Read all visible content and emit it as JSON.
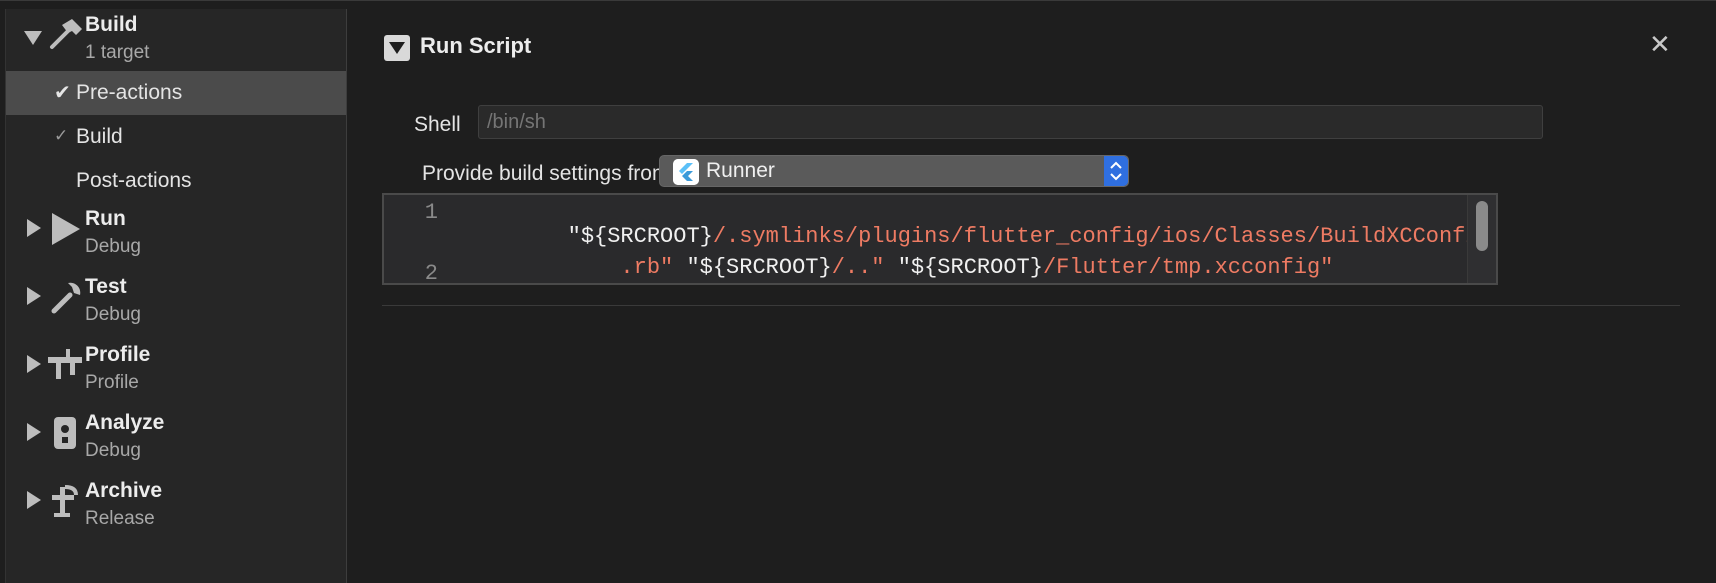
{
  "sidebar": {
    "schemes": [
      {
        "title": "Build",
        "subtitle": "1 target",
        "icon": "hammer-icon",
        "expanded": true
      },
      {
        "title": "Run",
        "subtitle": "Debug",
        "icon": "play-icon",
        "expanded": false
      },
      {
        "title": "Test",
        "subtitle": "Debug",
        "icon": "wrench-icon",
        "expanded": false
      },
      {
        "title": "Profile",
        "subtitle": "Profile",
        "icon": "caliper-icon",
        "expanded": false
      },
      {
        "title": "Analyze",
        "subtitle": "Debug",
        "icon": "analyze-icon",
        "expanded": false
      },
      {
        "title": "Archive",
        "subtitle": "Release",
        "icon": "archive-icon",
        "expanded": false
      }
    ],
    "build_phases": [
      {
        "label": "Pre-actions",
        "checked": true,
        "selected": true
      },
      {
        "label": "Build",
        "checked": true,
        "selected": false
      },
      {
        "label": "Post-actions",
        "checked": false,
        "selected": false
      }
    ],
    "check_glyph": "✔",
    "check_glyph_dim": "✓"
  },
  "run_script": {
    "title": "Run Script",
    "close_glyph": "✕",
    "shell_label": "Shell",
    "shell_placeholder": "/bin/sh",
    "provide_label": "Provide build settings from",
    "provide_value": "Runner",
    "code": {
      "line_numbers": [
        "1",
        "2"
      ],
      "line1": [
        {
          "t": "\"${SRCROOT}",
          "c": "str"
        },
        {
          "t": "/.symlinks/plugins/flutter_config/ios/Classes/BuildXCConfig",
          "c": "path"
        }
      ],
      "line2": [
        {
          "t": "    .rb\"",
          "c": "path"
        },
        {
          "t": " \"${SRCROOT}",
          "c": "str"
        },
        {
          "t": "/..\"",
          "c": "path"
        },
        {
          "t": " \"${SRCROOT}",
          "c": "str"
        },
        {
          "t": "/Flutter/tmp.xcconfig\"",
          "c": "path"
        }
      ]
    }
  },
  "colors": {
    "accent": "#2f6fe0",
    "code_path": "#ee7b63",
    "selected_row": "#4b4b4b"
  }
}
